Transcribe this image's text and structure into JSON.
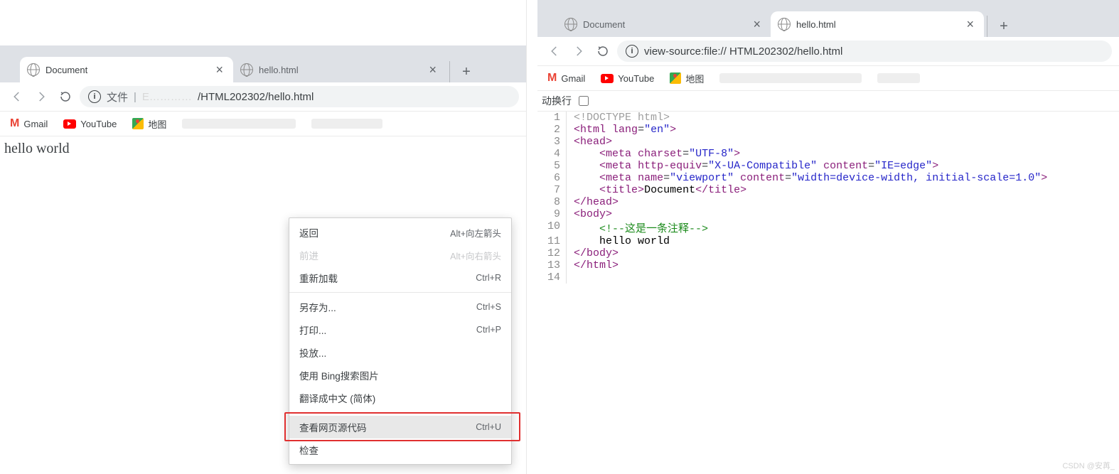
{
  "left": {
    "tabs": [
      {
        "title": "Document",
        "active": true
      },
      {
        "title": "hello.html",
        "active": false
      }
    ],
    "omni": {
      "label": "文件",
      "path": "/HTML202302/hello.html"
    },
    "bookmarks": {
      "gmail": "Gmail",
      "youtube": "YouTube",
      "maps": "地图"
    },
    "page_body": "hello world",
    "context_menu": [
      {
        "label": "返回",
        "shortcut": "Alt+向左箭头"
      },
      {
        "label": "前进",
        "shortcut": "Alt+向右箭头",
        "disabled": true
      },
      {
        "label": "重新加载",
        "shortcut": "Ctrl+R"
      },
      {
        "type": "sep"
      },
      {
        "label": "另存为...",
        "shortcut": "Ctrl+S"
      },
      {
        "label": "打印...",
        "shortcut": "Ctrl+P"
      },
      {
        "label": "投放..."
      },
      {
        "label": "使用 Bing搜索图片"
      },
      {
        "label": "翻译成中文 (简体)"
      },
      {
        "type": "sep"
      },
      {
        "label": "查看网页源代码",
        "shortcut": "Ctrl+U",
        "highlight": true
      },
      {
        "label": "检查"
      }
    ]
  },
  "right": {
    "tabs": [
      {
        "title": "Document",
        "active": false
      },
      {
        "title": "hello.html",
        "active": true
      }
    ],
    "omni": {
      "url": "view-source:file://       HTML202302/hello.html"
    },
    "bookmarks": {
      "gmail": "Gmail",
      "youtube": "YouTube",
      "maps": "地图"
    },
    "wrap_label": "动换行",
    "source_lines": [
      {
        "n": 1,
        "html": "<span class='doctype'>&lt;!DOCTYPE html&gt;</span>"
      },
      {
        "n": 2,
        "html": "<span class='punct'>&lt;</span><span class='tag'>html</span> <span class='attr'>lang</span>=<span class='val'>\"en\"</span><span class='punct'>&gt;</span>"
      },
      {
        "n": 3,
        "html": "<span class='punct'>&lt;</span><span class='tag'>head</span><span class='punct'>&gt;</span>"
      },
      {
        "n": 4,
        "html": "    <span class='punct'>&lt;</span><span class='tag'>meta</span> <span class='attr'>charset</span>=<span class='val'>\"UTF-8\"</span><span class='punct'>&gt;</span>"
      },
      {
        "n": 5,
        "html": "    <span class='punct'>&lt;</span><span class='tag'>meta</span> <span class='attr'>http-equiv</span>=<span class='val'>\"X-UA-Compatible\"</span> <span class='attr'>content</span>=<span class='val'>\"IE=edge\"</span><span class='punct'>&gt;</span>"
      },
      {
        "n": 6,
        "html": "    <span class='punct'>&lt;</span><span class='tag'>meta</span> <span class='attr'>name</span>=<span class='val'>\"viewport\"</span> <span class='attr'>content</span>=<span class='val'>\"width=device-width, initial-scale=1.0\"</span><span class='punct'>&gt;</span>"
      },
      {
        "n": 7,
        "html": "    <span class='punct'>&lt;</span><span class='tag'>title</span><span class='punct'>&gt;</span><span class='txt'>Document</span><span class='punct'>&lt;/</span><span class='tag'>title</span><span class='punct'>&gt;</span>"
      },
      {
        "n": 8,
        "html": "<span class='punct'>&lt;/</span><span class='tag'>head</span><span class='punct'>&gt;</span>"
      },
      {
        "n": 9,
        "html": "<span class='punct'>&lt;</span><span class='tag'>body</span><span class='punct'>&gt;</span>"
      },
      {
        "n": 10,
        "html": "    <span class='cmt'>&lt;!--这是一条注释--&gt;</span>"
      },
      {
        "n": 11,
        "html": "    <span class='txt'>hello world</span>"
      },
      {
        "n": 12,
        "html": "<span class='punct'>&lt;/</span><span class='tag'>body</span><span class='punct'>&gt;</span>"
      },
      {
        "n": 13,
        "html": "<span class='punct'>&lt;/</span><span class='tag'>html</span><span class='punct'>&gt;</span>"
      },
      {
        "n": 14,
        "html": ""
      }
    ]
  },
  "watermark": "CSDN @安苒_"
}
